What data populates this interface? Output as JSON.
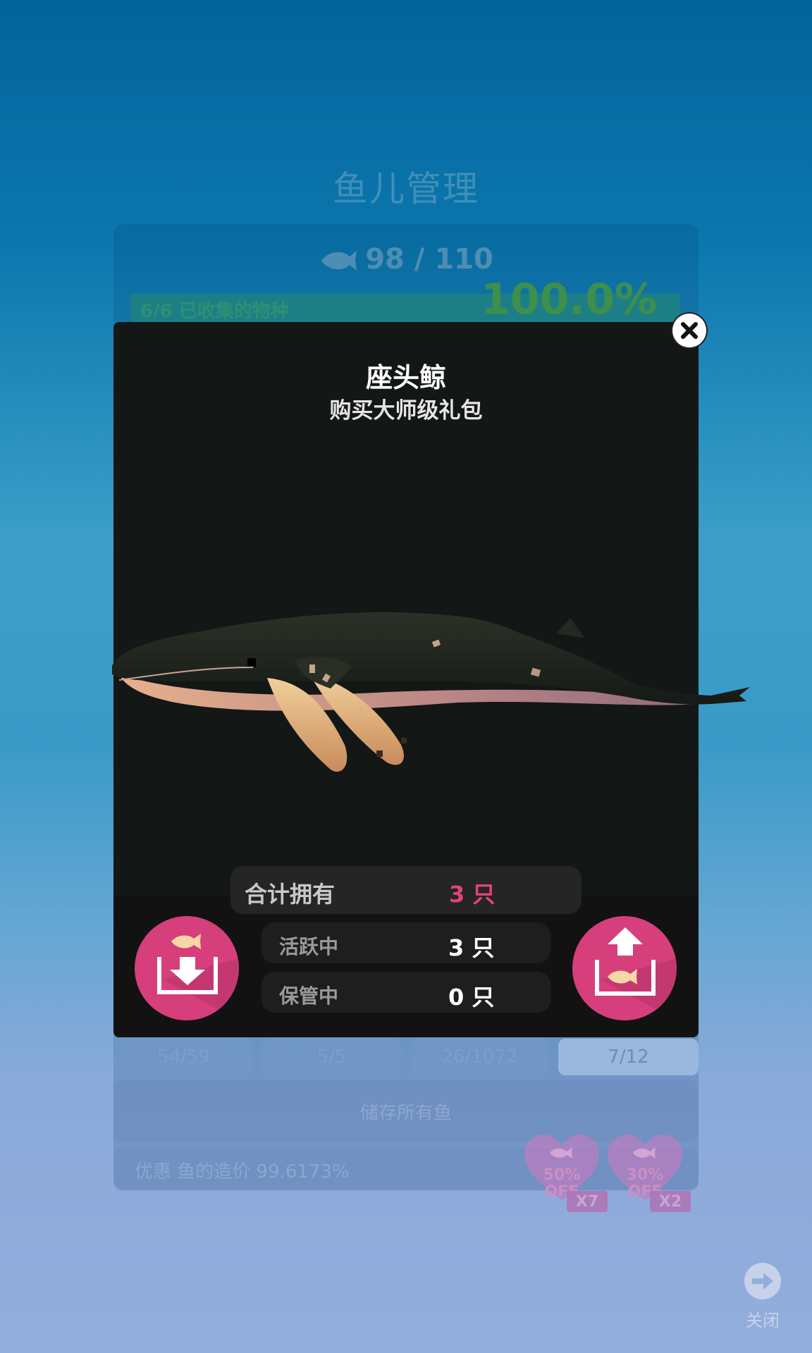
{
  "background": {
    "title": "鱼儿管理",
    "fish_count": "98 / 110",
    "progress_label": "6/6 已收集的物种",
    "progress_percent": "100.0%",
    "progress_value": 1.0,
    "tabs": [
      "54/59",
      "5/5",
      "26/1072",
      "7/12"
    ],
    "store_all_button": "储存所有鱼",
    "discount_text": "优惠 鱼的造价 99.6173%",
    "coupons": [
      {
        "percent": "50%",
        "off": "OFF",
        "count": "X7"
      },
      {
        "percent": "30%",
        "off": "OFF",
        "count": "X2"
      }
    ],
    "close_label": "关闭"
  },
  "modal": {
    "title": "座头鲸",
    "subtitle": "购买大师级礼包",
    "total_label": "合计拥有",
    "total_value": "3 只",
    "active_label": "活跃中",
    "active_value": "3 只",
    "stored_label": "保管中",
    "stored_value": "0 只"
  },
  "colors": {
    "accent": "#d63f7b",
    "modal_bg": "#131716"
  },
  "icons": {
    "close": "close-icon",
    "store": "store-fish-icon",
    "release": "release-fish-icon",
    "fish": "fish-icon"
  }
}
